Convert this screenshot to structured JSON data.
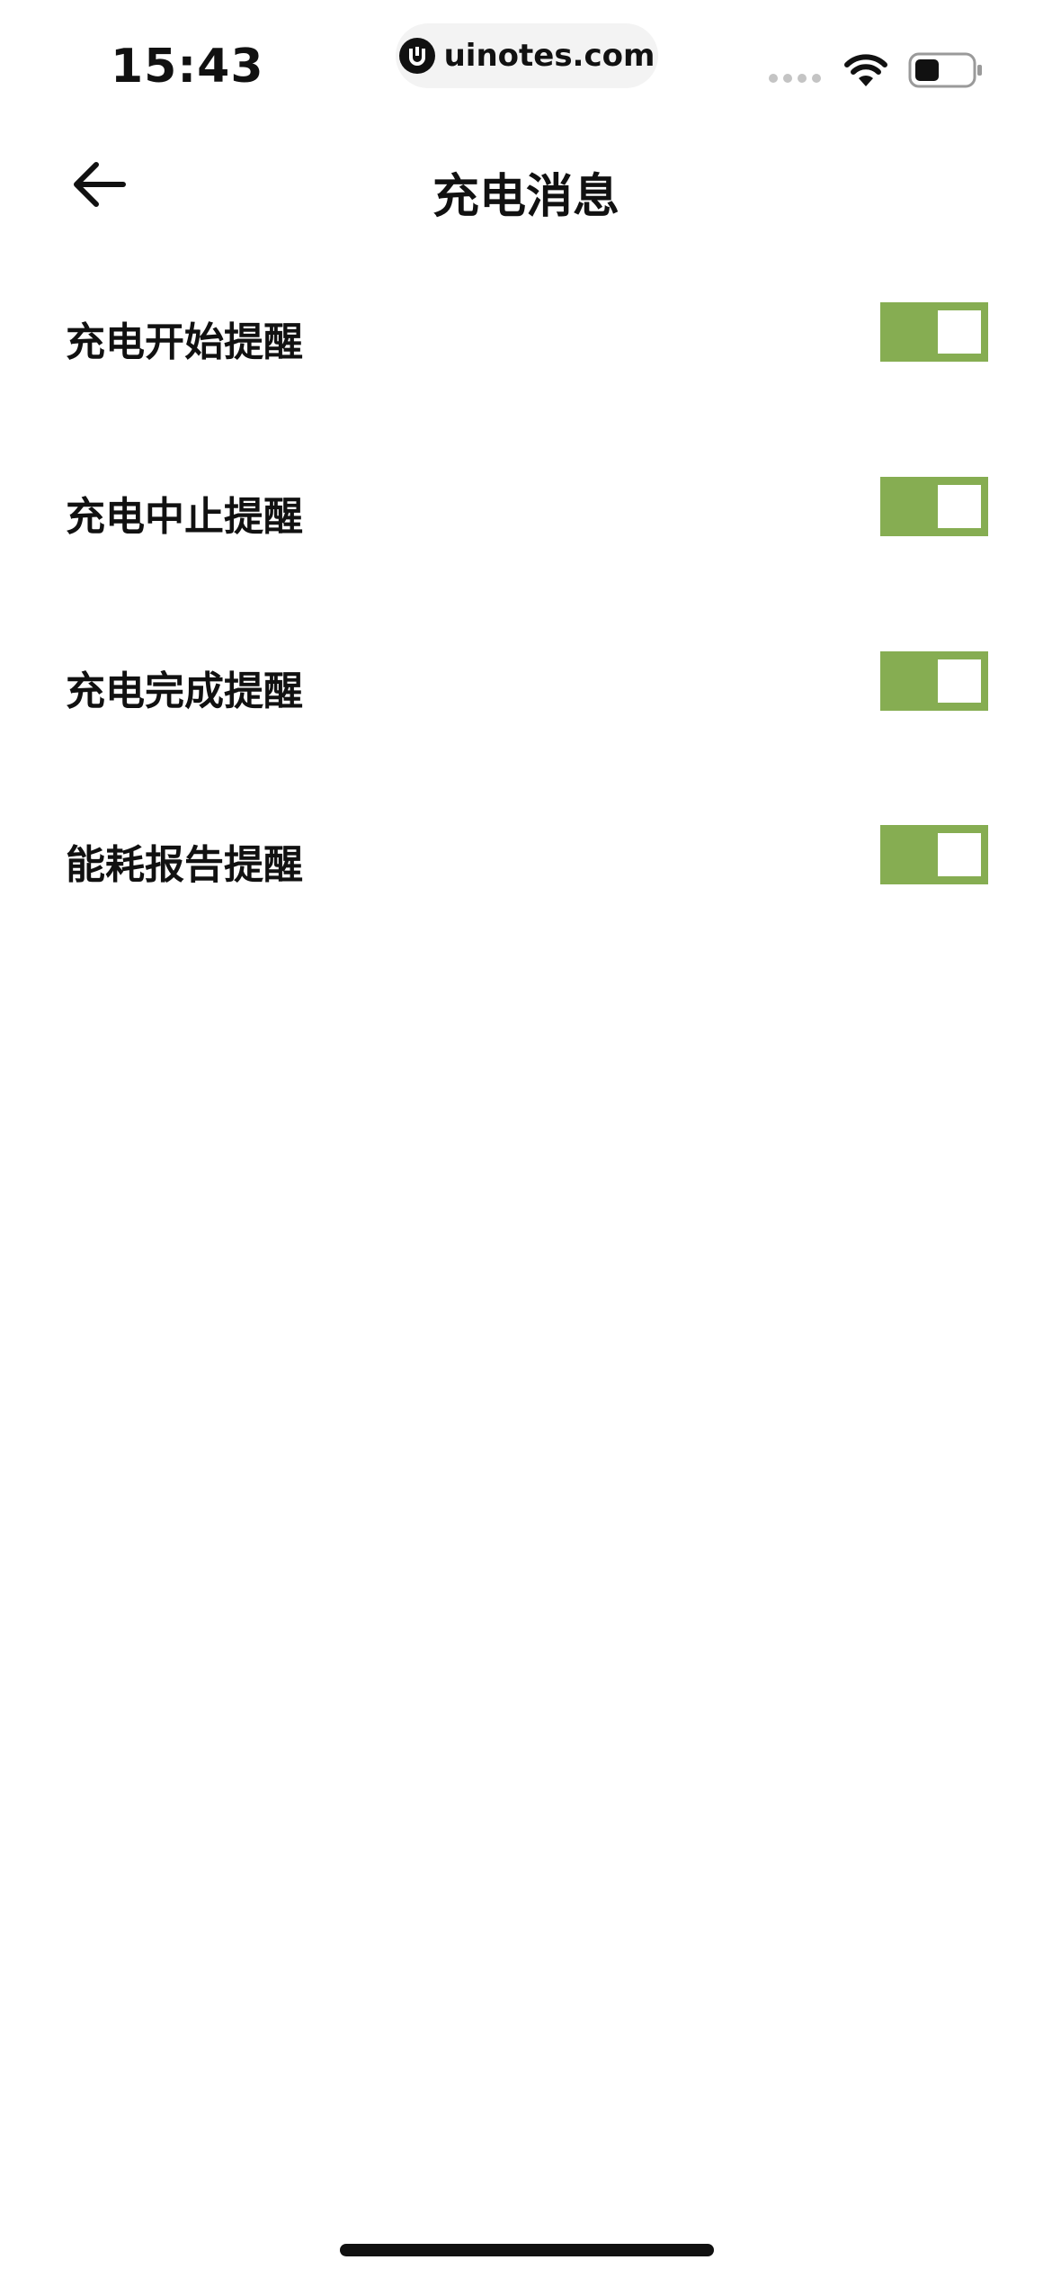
{
  "status_bar": {
    "time": "15:43",
    "url": "uinotes.com",
    "wifi_icon": "wifi-icon",
    "battery_icon": "battery-icon"
  },
  "header": {
    "back_icon": "arrow-left-icon",
    "title": "充电消息"
  },
  "settings": [
    {
      "label": "充电开始提醒",
      "enabled": true
    },
    {
      "label": "充电中止提醒",
      "enabled": true
    },
    {
      "label": "充电完成提醒",
      "enabled": true
    },
    {
      "label": "能耗报告提醒",
      "enabled": true
    }
  ],
  "colors": {
    "toggle_on": "#86ad52",
    "background": "#ffffff",
    "text": "#111111"
  }
}
